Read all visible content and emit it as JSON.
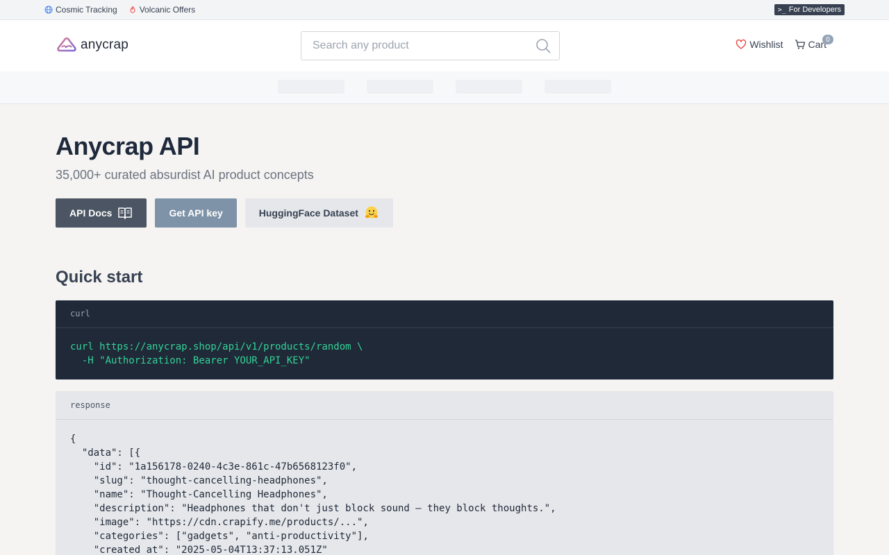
{
  "topbar": {
    "links": [
      {
        "label": "Cosmic Tracking",
        "icon": "globe-icon"
      },
      {
        "label": "Volcanic Offers",
        "icon": "flame-icon"
      }
    ],
    "dev_badge": {
      "prefix": ">_",
      "label": "For Developers"
    }
  },
  "header": {
    "logo_text": "anycrap",
    "search_placeholder": "Search any product",
    "wishlist_label": "Wishlist",
    "cart_label": "Cart",
    "cart_count": "0"
  },
  "hero": {
    "title": "Anycrap API",
    "subtitle": "35,000+ curated absurdist AI product concepts",
    "buttons": {
      "docs": "API Docs",
      "key": "Get API key",
      "dataset": "HuggingFace Dataset"
    }
  },
  "quickstart": {
    "heading": "Quick start",
    "request": {
      "label": "curl",
      "code": "curl https://anycrap.shop/api/v1/products/random \\\n  -H \"Authorization: Bearer YOUR_API_KEY\""
    },
    "response": {
      "label": "response",
      "code": "{\n  \"data\": [{\n    \"id\": \"1a156178-0240-4c3e-861c-47b6568123f0\",\n    \"slug\": \"thought-cancelling-headphones\",\n    \"name\": \"Thought-Cancelling Headphones\",\n    \"description\": \"Headphones that don't just block sound — they block thoughts.\",\n    \"image\": \"https://cdn.crapify.me/products/...\",\n    \"categories\": [\"gadgets\", \"anti-productivity\"],\n    \"created_at\": \"2025-05-04T13:37:13.051Z\""
    }
  },
  "colors": {
    "accent_dark": "#4b5563",
    "accent_mid": "#7f93a8",
    "code_green": "#34d399",
    "code_bg": "#1f2937"
  }
}
